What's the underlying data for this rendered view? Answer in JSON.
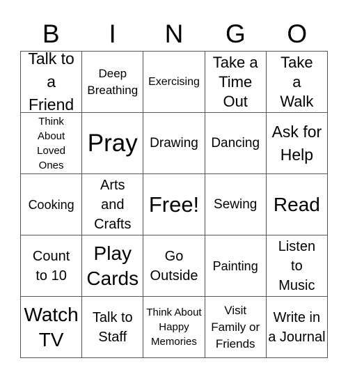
{
  "header": {
    "letters": [
      "B",
      "I",
      "N",
      "G",
      "O"
    ]
  },
  "board": {
    "rows": [
      [
        "Talk to a Friend",
        "Deep Breathing",
        "Exercising",
        "Take a Time Out",
        "Take a Walk"
      ],
      [
        "Think About Loved Ones",
        "Pray",
        "Drawing",
        "Dancing",
        "Ask for Help"
      ],
      [
        "Cooking",
        "Arts and Crafts",
        "Free!",
        "Sewing",
        "Read"
      ],
      [
        "Count to 10",
        "Play Cards",
        "Go Outside",
        "Painting",
        "Listen to Music"
      ],
      [
        "Watch TV",
        "Talk to Staff",
        "Think About Happy Memories",
        "Visit Family or Friends",
        "Write in a Journal"
      ]
    ],
    "free_space": "Free!"
  }
}
